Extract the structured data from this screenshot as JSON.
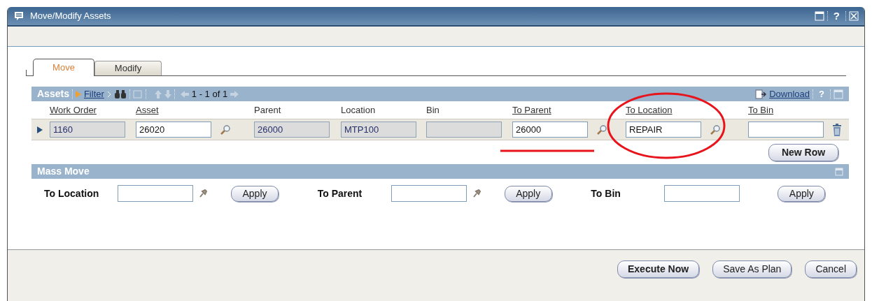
{
  "window": {
    "title": "Move/Modify Assets",
    "help": "?"
  },
  "tabs": [
    {
      "label": "Move",
      "selected": true
    },
    {
      "label": "Modify",
      "selected": false
    }
  ],
  "assets": {
    "title": "Assets",
    "filter": "Filter",
    "pager": "1 - 1 of 1",
    "download": "Download",
    "help": "?",
    "columns": [
      {
        "label": "Work Order",
        "link": true
      },
      {
        "label": "Asset",
        "link": true
      },
      {
        "label": "Parent",
        "link": false
      },
      {
        "label": "Location",
        "link": false
      },
      {
        "label": "Bin",
        "link": false
      },
      {
        "label": "To Parent",
        "link": true
      },
      {
        "label": "To Location",
        "link": true
      },
      {
        "label": "To Bin",
        "link": true
      }
    ],
    "rows": [
      {
        "cells": [
          {
            "value": "1160",
            "kind": "readonly",
            "lookup": false
          },
          {
            "value": "26020",
            "kind": "input",
            "lookup": true
          },
          {
            "value": "26000",
            "kind": "readonly",
            "lookup": false
          },
          {
            "value": "MTP100",
            "kind": "readonly",
            "lookup": false
          },
          {
            "kind": "readonly",
            "lookup": false
          },
          {
            "value": "26000",
            "kind": "input",
            "lookup": true
          },
          {
            "value": "REPAIR",
            "kind": "input",
            "lookup": true
          },
          {
            "kind": "input",
            "lookup": false
          }
        ]
      }
    ],
    "new_row": "New Row"
  },
  "mass_move": {
    "title": "Mass Move",
    "fields": [
      {
        "label": "To Location",
        "picker": true,
        "button": "Apply"
      },
      {
        "label": "To Parent",
        "picker": true,
        "button": "Apply"
      },
      {
        "label": "To Bin",
        "picker": false,
        "button": "Apply"
      }
    ]
  },
  "footer": {
    "buttons": [
      "Execute Now",
      "Save As Plan",
      "Cancel"
    ]
  }
}
